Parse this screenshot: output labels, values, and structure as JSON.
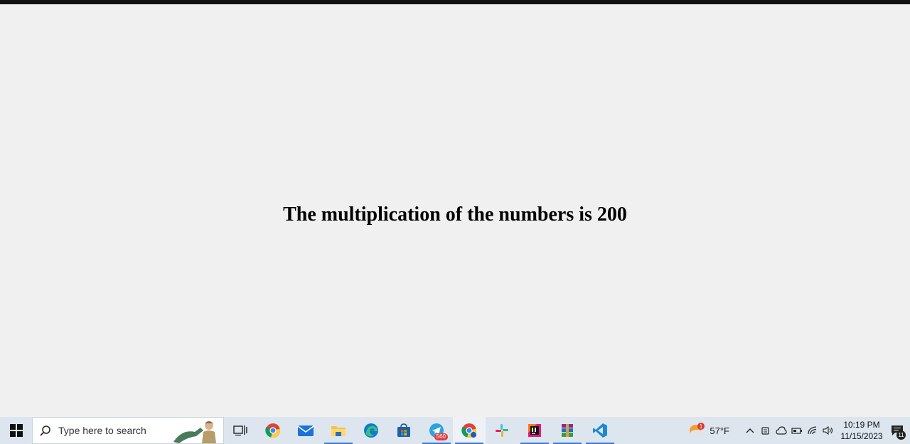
{
  "page": {
    "message": "The multiplication of the numbers is 200"
  },
  "taskbar": {
    "search_placeholder": "Type here to search",
    "pinned_apps": [
      {
        "name": "task-view",
        "icon": "task-view-icon"
      },
      {
        "name": "chrome",
        "icon": "chrome-icon"
      },
      {
        "name": "mail",
        "icon": "mail-icon"
      },
      {
        "name": "file-explorer",
        "icon": "folder-icon"
      },
      {
        "name": "edge",
        "icon": "edge-icon"
      },
      {
        "name": "microsoft-store",
        "icon": "store-icon"
      },
      {
        "name": "telegram",
        "icon": "telegram-icon",
        "badge": "560"
      },
      {
        "name": "chrome-profile",
        "icon": "chrome-icon"
      },
      {
        "name": "slack",
        "icon": "slack-icon"
      },
      {
        "name": "intellij",
        "icon": "intellij-icon"
      },
      {
        "name": "winrar",
        "icon": "winrar-icon"
      },
      {
        "name": "vscode",
        "icon": "vscode-icon"
      }
    ],
    "weather": {
      "temperature": "57°F",
      "alert_count": "1"
    },
    "clock": {
      "time": "10:19 PM",
      "date": "11/15/2023"
    },
    "notifications_count": "11"
  },
  "colors": {
    "taskbar_bg": "#dde6ef",
    "page_bg": "#f0f0f0",
    "accent": "#3a7bd5"
  }
}
